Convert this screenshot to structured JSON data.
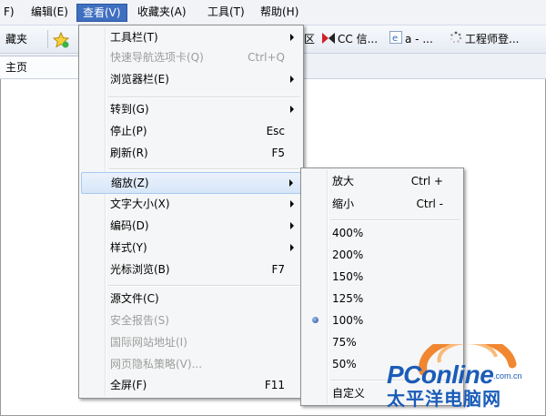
{
  "menubar": [
    {
      "label": "F)"
    },
    {
      "label": "编辑(E)"
    },
    {
      "label": "查看(V)"
    },
    {
      "label": "收藏夹(A)"
    },
    {
      "label": "工具(T)"
    },
    {
      "label": "帮助(H)"
    }
  ],
  "favorites": {
    "left_label": "藏夹",
    "items": [
      {
        "label": "区"
      },
      {
        "label": "CC 信..."
      },
      {
        "label": "a - ..."
      },
      {
        "label": "工程师登..."
      }
    ]
  },
  "tab": {
    "label": "主页"
  },
  "view_menu": [
    {
      "label": "工具栏(T)",
      "shortcut": "",
      "submenu": true,
      "disabled": false
    },
    {
      "label": "快速导航选项卡(Q)",
      "shortcut": "Ctrl+Q",
      "submenu": false,
      "disabled": true
    },
    {
      "label": "浏览器栏(E)",
      "shortcut": "",
      "submenu": true,
      "disabled": false
    },
    {
      "label": "转到(G)",
      "shortcut": "",
      "submenu": true,
      "disabled": false
    },
    {
      "label": "停止(P)",
      "shortcut": "Esc",
      "submenu": false,
      "disabled": false
    },
    {
      "label": "刷新(R)",
      "shortcut": "F5",
      "submenu": false,
      "disabled": false
    },
    {
      "label": "缩放(Z)",
      "shortcut": "",
      "submenu": true,
      "disabled": false
    },
    {
      "label": "文字大小(X)",
      "shortcut": "",
      "submenu": true,
      "disabled": false
    },
    {
      "label": "编码(D)",
      "shortcut": "",
      "submenu": true,
      "disabled": false
    },
    {
      "label": "样式(Y)",
      "shortcut": "",
      "submenu": true,
      "disabled": false
    },
    {
      "label": "光标浏览(B)",
      "shortcut": "F7",
      "submenu": false,
      "disabled": false
    },
    {
      "label": "源文件(C)",
      "shortcut": "",
      "submenu": false,
      "disabled": false
    },
    {
      "label": "安全报告(S)",
      "shortcut": "",
      "submenu": false,
      "disabled": true
    },
    {
      "label": "国际网站地址(I)",
      "shortcut": "",
      "submenu": false,
      "disabled": true
    },
    {
      "label": "网页隐私策略(V)...",
      "shortcut": "",
      "submenu": false,
      "disabled": true
    },
    {
      "label": "全屏(F)",
      "shortcut": "F11",
      "submenu": false,
      "disabled": false
    }
  ],
  "zoom_menu": [
    {
      "label": "放大",
      "shortcut": "Ctrl +"
    },
    {
      "label": "缩小",
      "shortcut": "Ctrl -"
    },
    {
      "label": "400%",
      "shortcut": ""
    },
    {
      "label": "200%",
      "shortcut": ""
    },
    {
      "label": "150%",
      "shortcut": ""
    },
    {
      "label": "125%",
      "shortcut": ""
    },
    {
      "label": "100%",
      "shortcut": "",
      "selected": true
    },
    {
      "label": "75%",
      "shortcut": ""
    },
    {
      "label": "50%",
      "shortcut": ""
    },
    {
      "label": "自定义",
      "shortcut": ""
    }
  ],
  "watermark": {
    "brand": "PConline",
    "domain": ".com.cn",
    "chinese": "太平洋电脑网"
  },
  "colors": {
    "menu_active": "#3f6fc0",
    "watermark_blue": "#1a5cb8",
    "watermark_orange": "#f07a1a"
  }
}
